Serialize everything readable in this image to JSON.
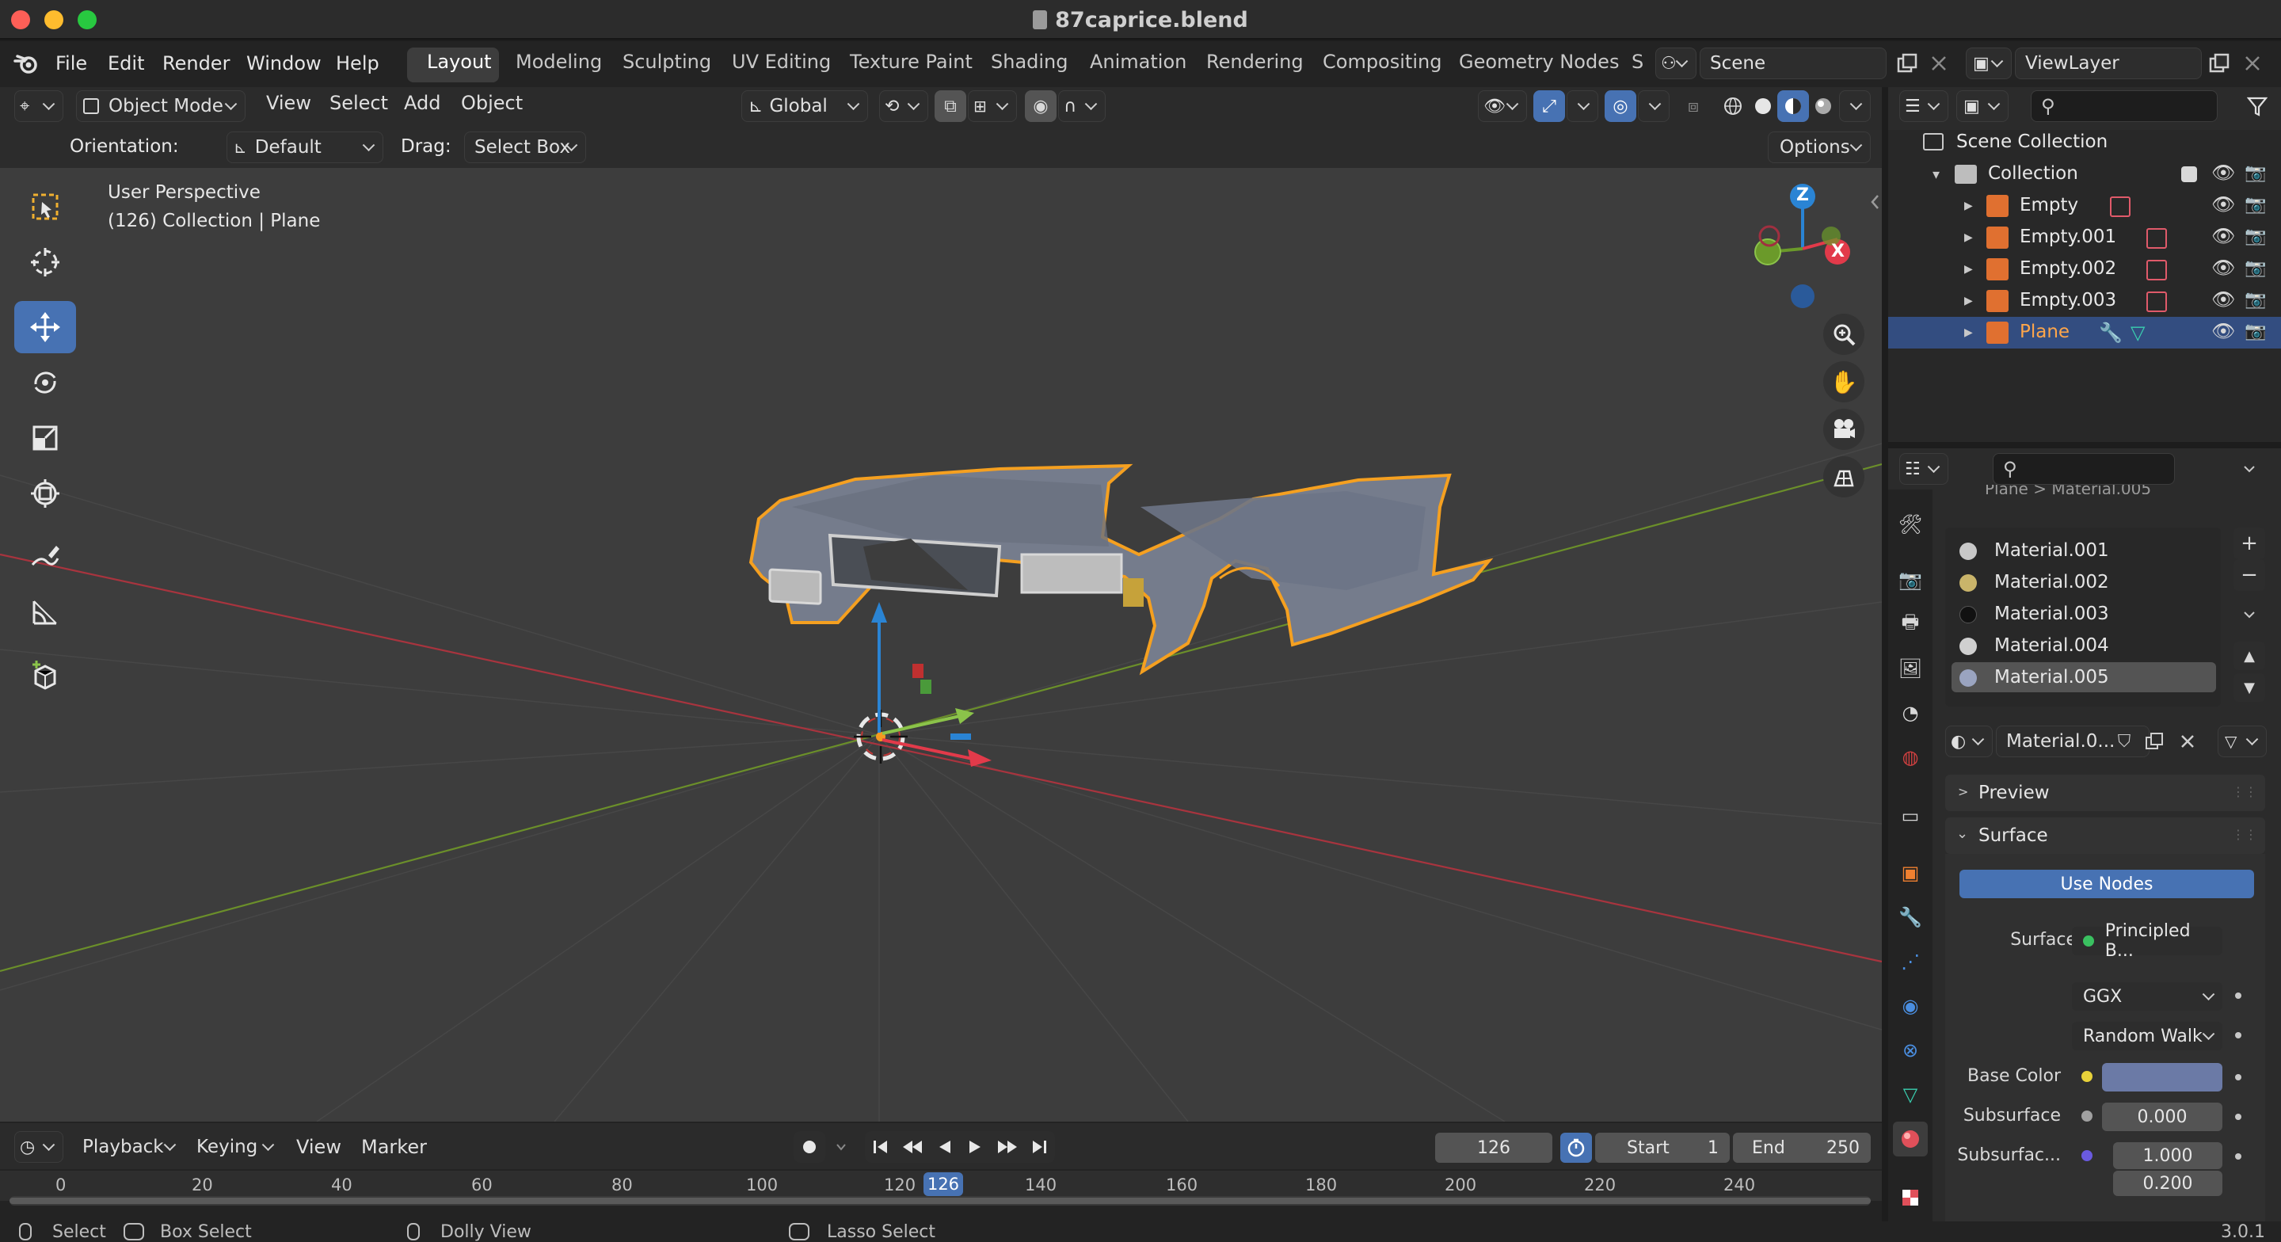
{
  "window": {
    "title": "87caprice.blend",
    "version": "3.0.1"
  },
  "menus": [
    "File",
    "Edit",
    "Render",
    "Window",
    "Help"
  ],
  "workspaces": [
    {
      "label": "Layout",
      "active": true
    },
    {
      "label": "Modeling"
    },
    {
      "label": "Sculpting"
    },
    {
      "label": "UV Editing"
    },
    {
      "label": "Texture Paint"
    },
    {
      "label": "Shading"
    },
    {
      "label": "Animation"
    },
    {
      "label": "Rendering"
    },
    {
      "label": "Compositing"
    },
    {
      "label": "Geometry Nodes"
    },
    {
      "label": "S"
    }
  ],
  "scene": {
    "name": "Scene",
    "view_layer": "ViewLayer"
  },
  "viewport_header": {
    "mode": "Object Mode",
    "menus": [
      "View",
      "Select",
      "Add",
      "Object"
    ],
    "transform_orientation": "Global"
  },
  "tool_header": {
    "orientation_label": "Orientation:",
    "orientation_value": "Default",
    "drag_label": "Drag:",
    "drag_value": "Select Box",
    "options_label": "Options"
  },
  "viewport": {
    "view_name": "User Perspective",
    "context": "(126) Collection | Plane",
    "axis_labels": {
      "z": "Z",
      "x": "X"
    }
  },
  "outliner": {
    "root": "Scene Collection",
    "collection": "Collection",
    "items": [
      {
        "name": "Empty"
      },
      {
        "name": "Empty.001"
      },
      {
        "name": "Empty.002"
      },
      {
        "name": "Empty.003"
      },
      {
        "name": "Plane",
        "selected": true
      }
    ]
  },
  "properties": {
    "breadcrumb": "Plane  >  Material.005",
    "materials": [
      {
        "name": "Material.001",
        "color": "#c8c8c8"
      },
      {
        "name": "Material.002",
        "color": "#c9b46a"
      },
      {
        "name": "Material.003",
        "color": "#111111"
      },
      {
        "name": "Material.004",
        "color": "#d0d0d0"
      },
      {
        "name": "Material.005",
        "color": "#9aa4c0",
        "selected": true
      }
    ],
    "material_field": "Material.0...",
    "panels": {
      "preview": "Preview",
      "surface": "Surface"
    },
    "use_nodes": "Use Nodes",
    "surface_label": "Surface",
    "surface_value": "Principled B...",
    "distribution": "GGX",
    "subsurface_method": "Random Walk",
    "base_color_label": "Base Color",
    "base_color": "#6b7aa6",
    "subsurface_label": "Subsurface",
    "subsurface_value": "0.000",
    "subsurface_radius_label": "Subsurfac...",
    "subsurface_radius_values": [
      "1.000",
      "0.200"
    ]
  },
  "timeline": {
    "menus": [
      "Playback",
      "Keying",
      "View",
      "Marker"
    ],
    "current_frame": "126",
    "start_label": "Start",
    "start": "1",
    "end_label": "End",
    "end": "250",
    "ticks": [
      "0",
      "20",
      "40",
      "60",
      "80",
      "100",
      "120",
      "140",
      "160",
      "180",
      "200",
      "220",
      "240"
    ],
    "frame_badge": "126"
  },
  "statusbar": {
    "items": [
      "Select",
      "Box Select",
      "Dolly View",
      "Lasso Select"
    ]
  },
  "colors": {
    "accent": "#4772b3",
    "selection_outline": "#f5a020",
    "axis_x": "#e23a4a",
    "axis_y": "#8bc34a",
    "axis_z": "#2a84d4"
  }
}
